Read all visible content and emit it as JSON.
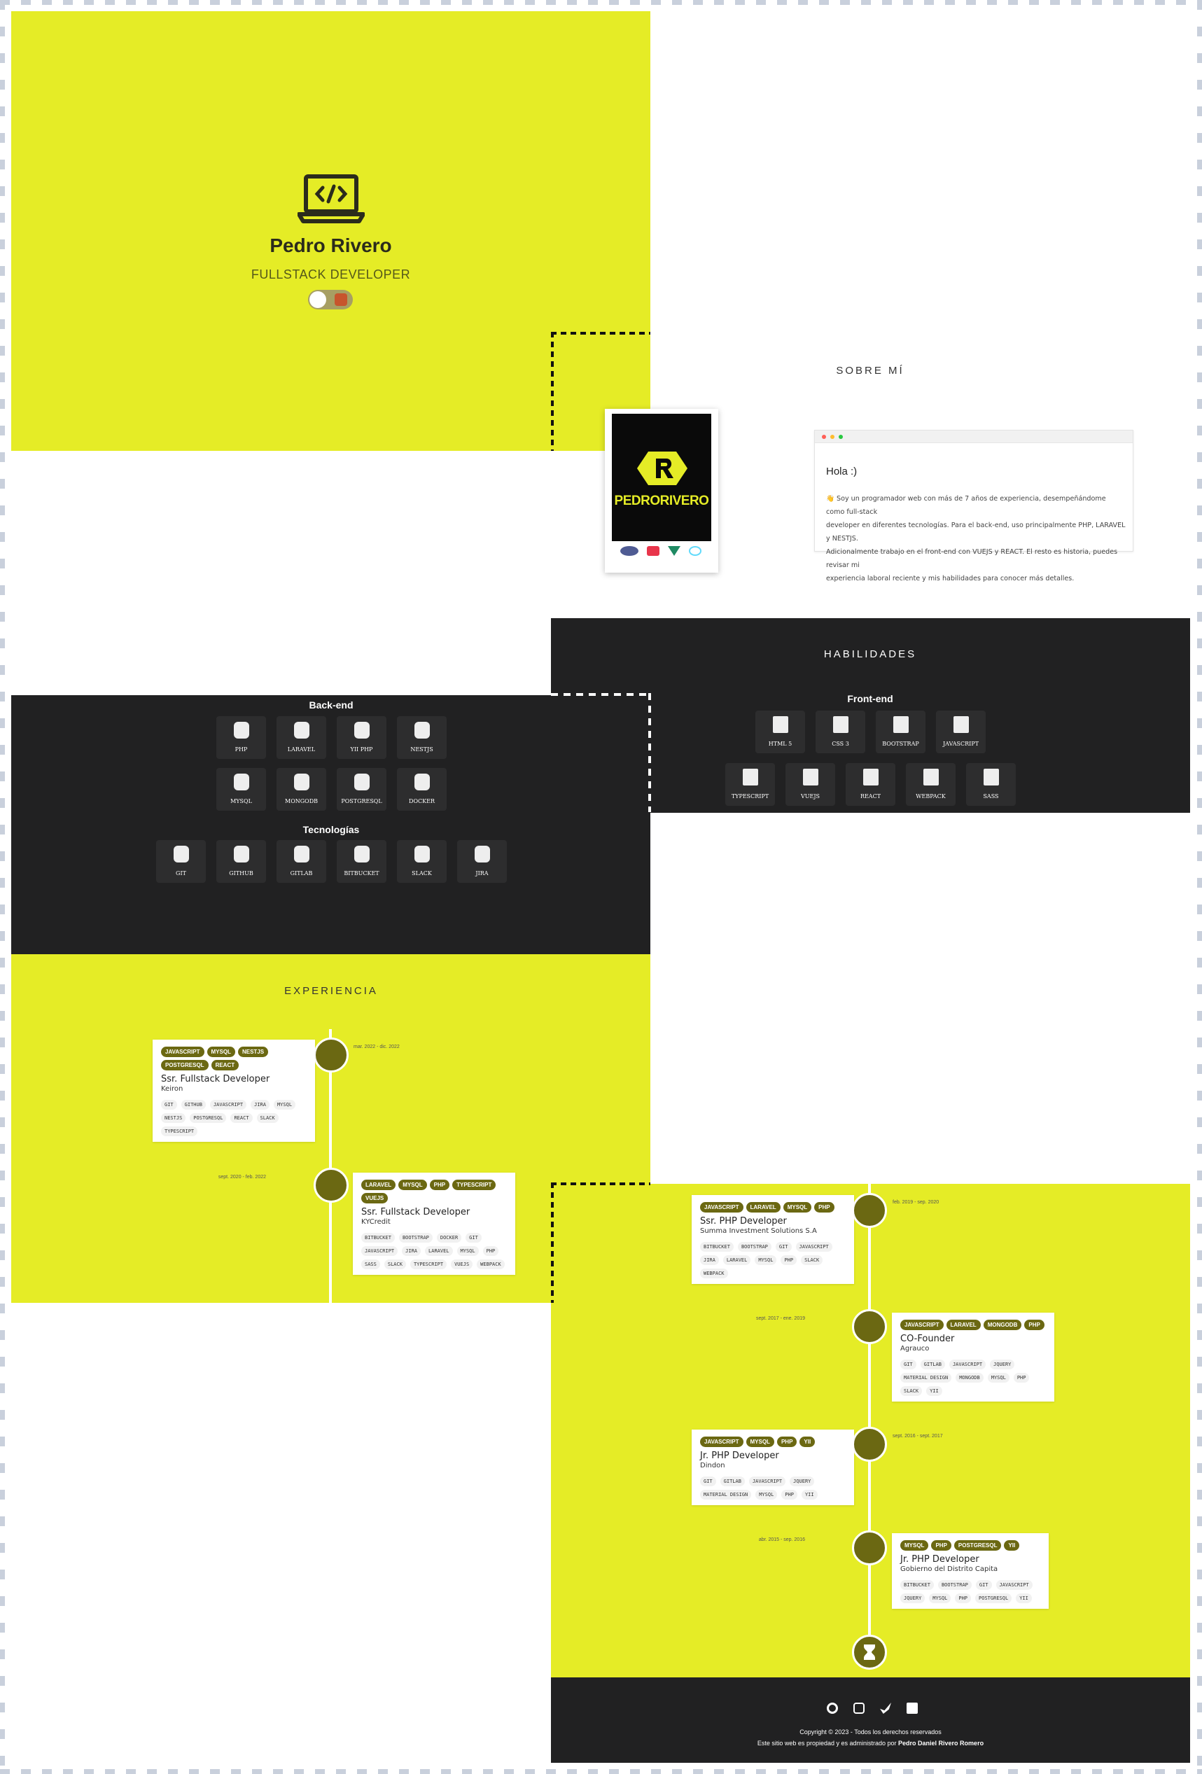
{
  "hero": {
    "name": "Pedro Rivero",
    "role": "FULLSTACK DEVELOPER",
    "icon": "laptop-code-icon",
    "theme_toggle": "theme-toggle"
  },
  "about": {
    "title": "SOBRE MÍ",
    "logo_text": "PEDRORIVERO",
    "greeting": "Hola :)",
    "bio_lines": [
      "👋 Soy un programador web con más de 7 años de experiencia, desempeñándome como full-stack",
      "developer en diferentes tecnologías. Para el back-end, uso principalmente PHP, LARAVEL y NESTJS.",
      "Adicionalmente trabajo en el front-end con VUEJS y REACT. El resto es historia, puedes revisar mi",
      "experiencia laboral reciente y mis habilidades para conocer más detalles."
    ]
  },
  "skills": {
    "title": "HABILIDADES",
    "frontend_title": "Front-end",
    "frontend": [
      "HTML 5",
      "CSS 3",
      "BOOTSTRAP",
      "JAVASCRIPT",
      "TYPESCRIPT",
      "VUEJS",
      "REACT",
      "WEBPACK",
      "SASS"
    ],
    "backend_title": "Back-end",
    "backend": [
      "PHP",
      "LARAVEL",
      "YII PHP",
      "NESTJS",
      "MYSQL",
      "MONGODB",
      "POSTGRESQL",
      "DOCKER"
    ],
    "tech_title": "Tecnologías",
    "tech": [
      "GIT",
      "GITHUB",
      "GITLAB",
      "BITBUCKET",
      "SLACK",
      "JIRA"
    ]
  },
  "experience": {
    "title": "EXPERIENCIA",
    "jobs": [
      {
        "date": "mar. 2022 - dic. 2022",
        "role": "Ssr. Fullstack Developer",
        "company": "Keiron",
        "tags": [
          "JAVASCRIPT",
          "MYSQL",
          "NESTJS",
          "POSTGRESQL",
          "REACT"
        ],
        "skills": [
          "GIT",
          "GITHUB",
          "JAVASCRIPT",
          "JIRA",
          "MYSQL",
          "NESTJS",
          "POSTGRESQL",
          "REACT",
          "SLACK",
          "TYPESCRIPT"
        ]
      },
      {
        "date": "sept. 2020 - feb. 2022",
        "role": "Ssr. Fullstack Developer",
        "company": "KYCredit",
        "tags": [
          "LARAVEL",
          "MYSQL",
          "PHP",
          "TYPESCRIPT",
          "VUEJS"
        ],
        "skills": [
          "BITBUCKET",
          "BOOTSTRAP",
          "DOCKER",
          "GIT",
          "JAVASCRIPT",
          "JIRA",
          "LARAVEL",
          "MYSQL",
          "PHP",
          "SASS",
          "SLACK",
          "TYPESCRIPT",
          "VUEJS",
          "WEBPACK"
        ]
      },
      {
        "date": "feb. 2019 - sep. 2020",
        "role": "Ssr. PHP Developer",
        "company": "Summa Investment Solutions S.A",
        "tags": [
          "JAVASCRIPT",
          "LARAVEL",
          "MYSQL",
          "PHP"
        ],
        "skills": [
          "BITBUCKET",
          "BOOTSTRAP",
          "GIT",
          "JAVASCRIPT",
          "JIRA",
          "LARAVEL",
          "MYSQL",
          "PHP",
          "SLACK",
          "WEBPACK"
        ]
      },
      {
        "date": "sept. 2017 - ene. 2019",
        "role": "CO-Founder",
        "company": "Agrauco",
        "tags": [
          "JAVASCRIPT",
          "LARAVEL",
          "MONGODB",
          "PHP"
        ],
        "skills": [
          "GIT",
          "GITLAB",
          "JAVASCRIPT",
          "JQUERY",
          "MATERIAL DESIGN",
          "MONGODB",
          "MYSQL",
          "PHP",
          "SLACK",
          "YII"
        ]
      },
      {
        "date": "sept. 2016 - sept. 2017",
        "role": "Jr. PHP Developer",
        "company": "Dindon",
        "tags": [
          "JAVASCRIPT",
          "MYSQL",
          "PHP",
          "YII"
        ],
        "skills": [
          "GIT",
          "GITLAB",
          "JAVASCRIPT",
          "JQUERY",
          "MATERIAL DESIGN",
          "MYSQL",
          "PHP",
          "YII"
        ]
      },
      {
        "date": "abr. 2015 - sep. 2016",
        "role": "Jr. PHP Developer",
        "company": "Gobierno del Distrito Capita",
        "tags": [
          "MYSQL",
          "PHP",
          "POSTGRESQL",
          "YII"
        ],
        "skills": [
          "BITBUCKET",
          "BOOTSTRAP",
          "GIT",
          "JAVASCRIPT",
          "JQUERY",
          "MYSQL",
          "PHP",
          "POSTGRESQL",
          "YII"
        ]
      }
    ]
  },
  "footer": {
    "icons": [
      "github-icon",
      "instagram-icon",
      "twitter-icon",
      "linkedin-icon"
    ],
    "copyright": "Copyright © 2023 - Todos los derechos reservados",
    "ownership_prefix": "Este sitio web es propiedad y es administrado por",
    "owner": "Pedro Daniel Rivero Romero"
  },
  "colors": {
    "yellow": "#e5ec26",
    "dark": "#212122",
    "olive": "#6b6812"
  }
}
